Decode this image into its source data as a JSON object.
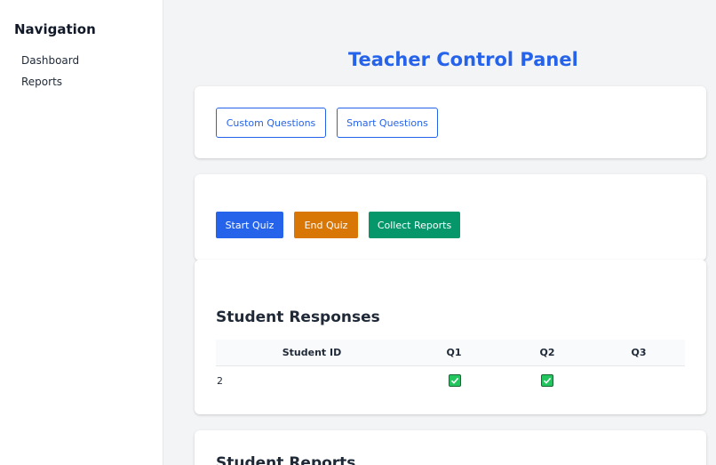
{
  "sidebar": {
    "title": "Navigation",
    "items": [
      {
        "label": "Dashboard"
      },
      {
        "label": "Reports"
      }
    ]
  },
  "main": {
    "title": "Teacher Control Panel",
    "question_buttons": {
      "custom": "Custom Questions",
      "smart": "Smart Questions"
    },
    "quiz_buttons": {
      "start": "Start Quiz",
      "end": "End Quiz",
      "collect": "Collect Reports"
    },
    "responses": {
      "title": "Student Responses",
      "columns": [
        "Student ID",
        "Q1",
        "Q2",
        "Q3"
      ],
      "rows": [
        {
          "student_id": "2",
          "q1": "correct",
          "q2": "correct",
          "q3": ""
        }
      ]
    },
    "reports": {
      "title": "Student Reports"
    }
  },
  "colors": {
    "primary": "#2563eb",
    "warning": "#d97706",
    "success": "#059669",
    "check": "#22c55e"
  },
  "icons": {
    "check": "check-mark-icon"
  }
}
